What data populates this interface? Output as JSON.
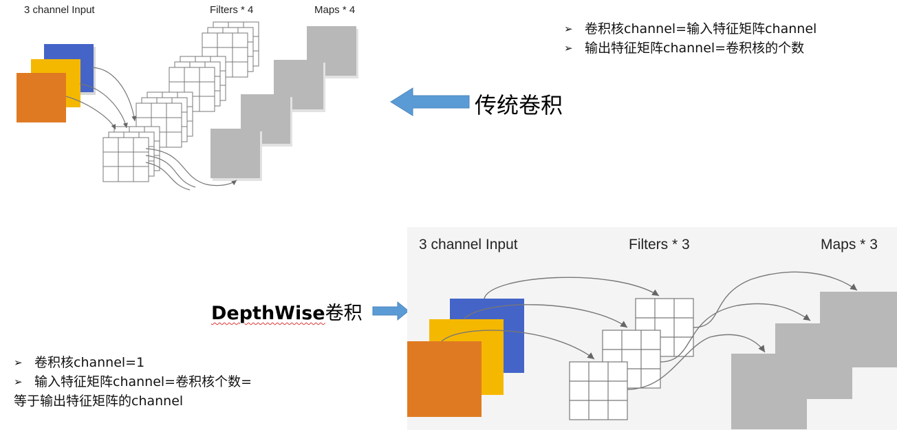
{
  "top_diagram": {
    "label_input": "3 channel Input",
    "label_filters": "Filters * 4",
    "label_maps": "Maps * 4",
    "colors": {
      "blue": "#4464c7",
      "yellow": "#f5b800",
      "orange": "#e07a22",
      "gray": "#b8b8b8"
    }
  },
  "standard_conv": {
    "title": "传统卷积",
    "bullets": [
      "卷积核channel=输入特征矩阵channel",
      "输出特征矩阵channel=卷积核的个数"
    ]
  },
  "depthwise_conv": {
    "title_en": "DepthWise",
    "title_cn": "卷积",
    "bullets": [
      "卷积核channel=1",
      "输入特征矩阵channel=卷积核个数="
    ],
    "continuation": "等于输出特征矩阵的channel"
  },
  "bottom_diagram": {
    "label_input": "3 channel Input",
    "label_filters": "Filters * 3",
    "label_maps": "Maps * 3"
  },
  "arrow_color": "#5b9bd5"
}
